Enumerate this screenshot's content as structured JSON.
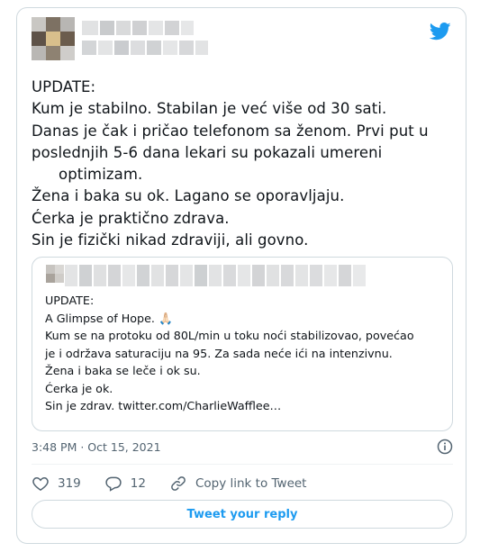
{
  "tweet": {
    "lines": [
      "UPDATE:",
      "Kum je stabilno. Stabilan je već više od 30 sati.",
      "Danas je čak i pričao telefonom sa ženom. Prvi put u",
      "poslednjih 5-6 dana lekari su pokazali umereni",
      "optimizam.",
      "Žena i baka su ok. Lagano se oporavljaju.",
      "Ćerka je praktično zdrava.",
      "Sin je fizički nikad zdraviji, ali govno."
    ]
  },
  "quoted_tweet": {
    "lines": [
      "UPDATE:",
      "A Glimpse of Hope. 🙏🏻",
      "Kum se na protoku od 80L/min u toku noći stabilizovao, povećao",
      "je i održava saturaciju na 95. Za sada neće ići na intenzivnu.",
      "Žena i baka se leče i ok su.",
      "Ćerka je ok.",
      "Sin je zdrav. twitter.com/CharlieWafflee…"
    ]
  },
  "timestamp": "3:48 PM · Oct 15, 2021",
  "actions": {
    "likes": "319",
    "replies": "12",
    "copy_link": "Copy link to Tweet"
  },
  "reply_button": "Tweet your reply",
  "icons": {
    "brand": "twitter-bird-icon",
    "info": "info-icon",
    "like": "heart-icon",
    "reply": "reply-bubble-icon",
    "link": "link-icon"
  },
  "colors": {
    "accent": "#1d9bf0",
    "text": "#0f1419",
    "muted": "#536471",
    "border": "#cfd9de"
  }
}
